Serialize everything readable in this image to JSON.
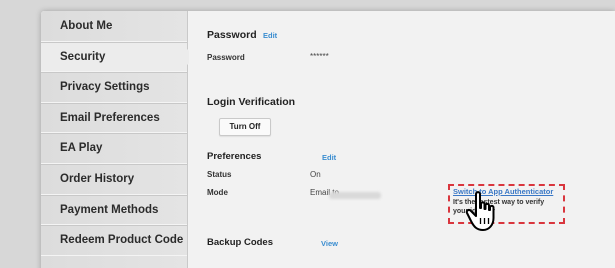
{
  "sidebar": {
    "items": [
      {
        "label": "About Me"
      },
      {
        "label": "Security"
      },
      {
        "label": "Privacy Settings"
      },
      {
        "label": "Email Preferences"
      },
      {
        "label": "EA Play"
      },
      {
        "label": "Order History"
      },
      {
        "label": "Payment Methods"
      },
      {
        "label": "Redeem Product Code"
      }
    ],
    "active": "Security"
  },
  "password": {
    "heading": "Password",
    "edit_label": "Edit",
    "label": "Password",
    "value": "******"
  },
  "login_verification": {
    "heading": "Login Verification",
    "button_label": "Turn Off"
  },
  "preferences": {
    "heading": "Preferences",
    "edit_label": "Edit",
    "status_label": "Status",
    "status_value": "On",
    "mode_label": "Mode",
    "mode_value": "Email to"
  },
  "authenticator": {
    "link_label": "Switch to App Authenticator",
    "description": "It's the fastest way to verify your identity"
  },
  "backup_codes": {
    "heading": "Backup Codes",
    "view_label": "View"
  },
  "colors": {
    "link": "#3a8dd0",
    "highlight": "#d9363e"
  }
}
